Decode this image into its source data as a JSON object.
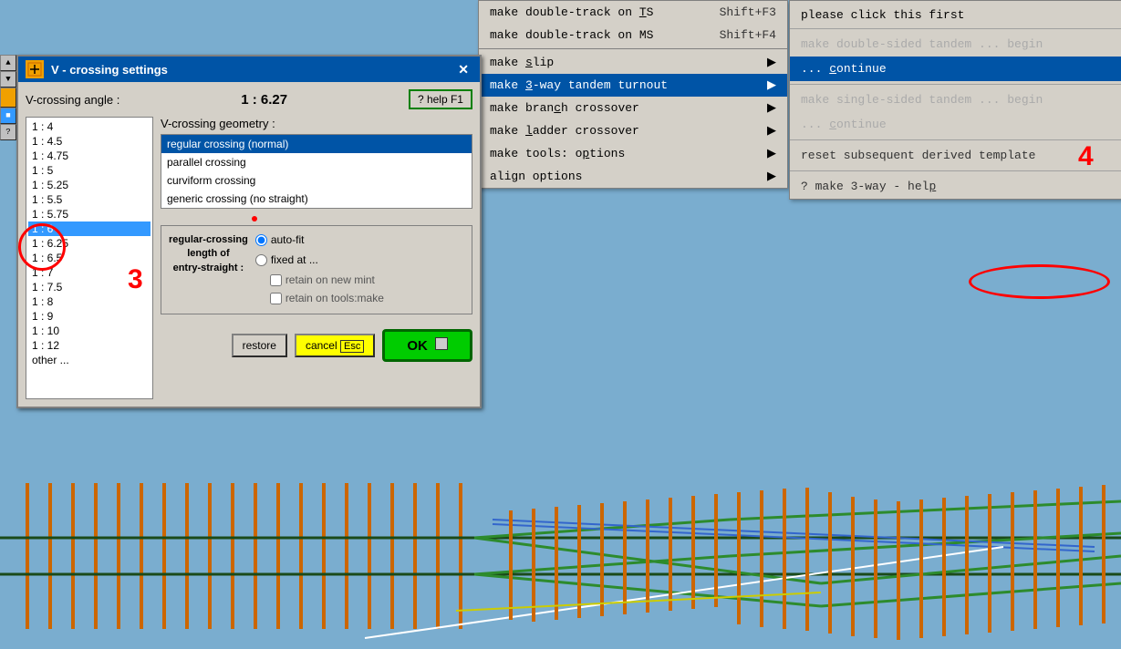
{
  "dialog": {
    "title": "V - crossing  settings",
    "close_label": "✕",
    "help_label": "? help  F1",
    "ratio_value": "1 : 6.27",
    "vcrossing_label": "V-crossing angle :",
    "geometry_label": "V-crossing  geometry :",
    "ratios": [
      {
        "label": "1 : 4",
        "selected": false
      },
      {
        "label": "1 : 4.5",
        "selected": false
      },
      {
        "label": "1 : 4.75",
        "selected": false
      },
      {
        "label": "1 : 5",
        "selected": false
      },
      {
        "label": "1 : 5.25",
        "selected": false
      },
      {
        "label": "1 : 5.5",
        "selected": false
      },
      {
        "label": "1 : 5.75",
        "selected": false
      },
      {
        "label": "1 : 6",
        "selected": true,
        "highlighted": true
      },
      {
        "label": "1 : 6.25",
        "selected": false
      },
      {
        "label": "1 : 6.5",
        "selected": false
      },
      {
        "label": "1 : 7",
        "selected": false
      },
      {
        "label": "1 : 7.5",
        "selected": false
      },
      {
        "label": "1 : 8",
        "selected": false
      },
      {
        "label": "1 : 9",
        "selected": false
      },
      {
        "label": "1 : 10",
        "selected": false
      },
      {
        "label": "1 : 12",
        "selected": false
      },
      {
        "label": "other ...",
        "selected": false
      }
    ],
    "geometries": [
      {
        "label": "regular crossing (normal)",
        "selected": true
      },
      {
        "label": "parallel crossing",
        "selected": false
      },
      {
        "label": "curviform crossing",
        "selected": false
      },
      {
        "label": "generic crossing (no straight)",
        "selected": false
      }
    ],
    "length_box_title": "regular-crossing\nlength of\nentry-straight :",
    "radio_autofit": "auto-fit",
    "radio_fixed": "fixed at ...",
    "checkbox_retain_new": "retain  on  new  mint",
    "checkbox_retain_tools": "retain  on  tools:make",
    "btn_restore": "restore",
    "btn_cancel": "cancel",
    "btn_cancel_key": "Esc",
    "btn_ok": "OK"
  },
  "menu": {
    "items": [
      {
        "label": "make  double-track  on  TS",
        "shortcut": "Shift+F3",
        "has_arrow": false
      },
      {
        "label": "make  double-track  on  MS",
        "shortcut": "Shift+F4",
        "has_arrow": false
      },
      {
        "label": "",
        "separator": true
      },
      {
        "label": "make  slip",
        "shortcut": "",
        "has_arrow": true
      },
      {
        "label": "make  3-way  tandem  turnout",
        "shortcut": "",
        "has_arrow": true,
        "active": true
      },
      {
        "label": "make  branch  crossover",
        "shortcut": "",
        "has_arrow": true
      },
      {
        "label": "make  ladder  crossover",
        "shortcut": "",
        "has_arrow": true
      },
      {
        "label": "make  tools:  options",
        "shortcut": "",
        "has_arrow": true
      },
      {
        "label": "align  options",
        "shortcut": "",
        "has_arrow": true
      }
    ]
  },
  "side_panel": {
    "title": "please   click this first",
    "items": [
      {
        "label": "make  double-sided  tandem  ...  begin",
        "disabled": true
      },
      {
        "label": "...  continue",
        "highlighted": true
      },
      {
        "label": "make  single-sided  tandem  ...  begin",
        "disabled": true
      },
      {
        "label": "...  continue",
        "disabled": true
      },
      {
        "separator": true
      },
      {
        "label": "reset  subsequent  derived  template",
        "disabled": false
      },
      {
        "separator": true
      },
      {
        "label": "?  make  3-way  -  help",
        "disabled": false
      }
    ]
  },
  "annotations": {
    "label_3": "3",
    "label_4": "4"
  }
}
